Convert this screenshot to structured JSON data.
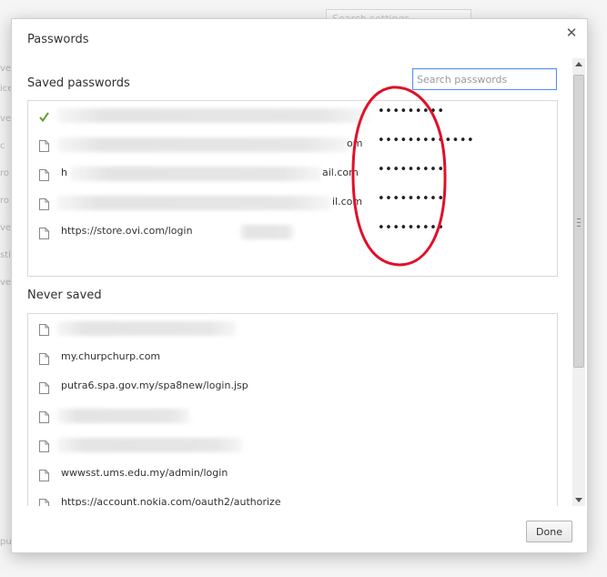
{
  "background": {
    "search_placeholder": "Search settings",
    "fragments": [
      "ve",
      "ice",
      "ve",
      "c",
      "ro",
      "ro",
      "ve",
      "sti",
      "ve",
      "pu"
    ]
  },
  "dialog": {
    "title": "Passwords",
    "close_glyph": "✕",
    "saved_passwords": {
      "heading": "Saved passwords",
      "search_placeholder": "Search passwords",
      "rows": [
        {
          "icon": "checkmark-icon",
          "site": "",
          "username": "",
          "password": "•••••••••"
        },
        {
          "icon": "page-icon",
          "site": "",
          "username": "om",
          "password": "•••••••••••••"
        },
        {
          "icon": "page-icon",
          "site": "h",
          "username": "ail.com",
          "password": "•••••••••"
        },
        {
          "icon": "page-icon",
          "site": "",
          "username": "il.com",
          "password": "•••••••••"
        },
        {
          "icon": "page-icon",
          "site": "https://store.ovi.com/login",
          "username": "",
          "password": "•••••••••"
        }
      ]
    },
    "never_saved": {
      "heading": "Never saved",
      "rows": [
        {
          "icon": "page-icon",
          "site": ""
        },
        {
          "icon": "page-icon",
          "site": "my.churpchurp.com"
        },
        {
          "icon": "page-icon",
          "site": "putra6.spa.gov.my/spa8new/login.jsp"
        },
        {
          "icon": "page-icon",
          "site": ""
        },
        {
          "icon": "page-icon",
          "site": ""
        },
        {
          "icon": "page-icon",
          "site": "wwwsst.ums.edu.my/admin/login"
        },
        {
          "icon": "page-icon",
          "site": "https://account.nokia.com/oauth2/authorize"
        }
      ]
    },
    "done_label": "Done"
  },
  "colors": {
    "annotation": "#e0102a",
    "check": "#5aa02c",
    "focus_border": "#4d90fe"
  }
}
